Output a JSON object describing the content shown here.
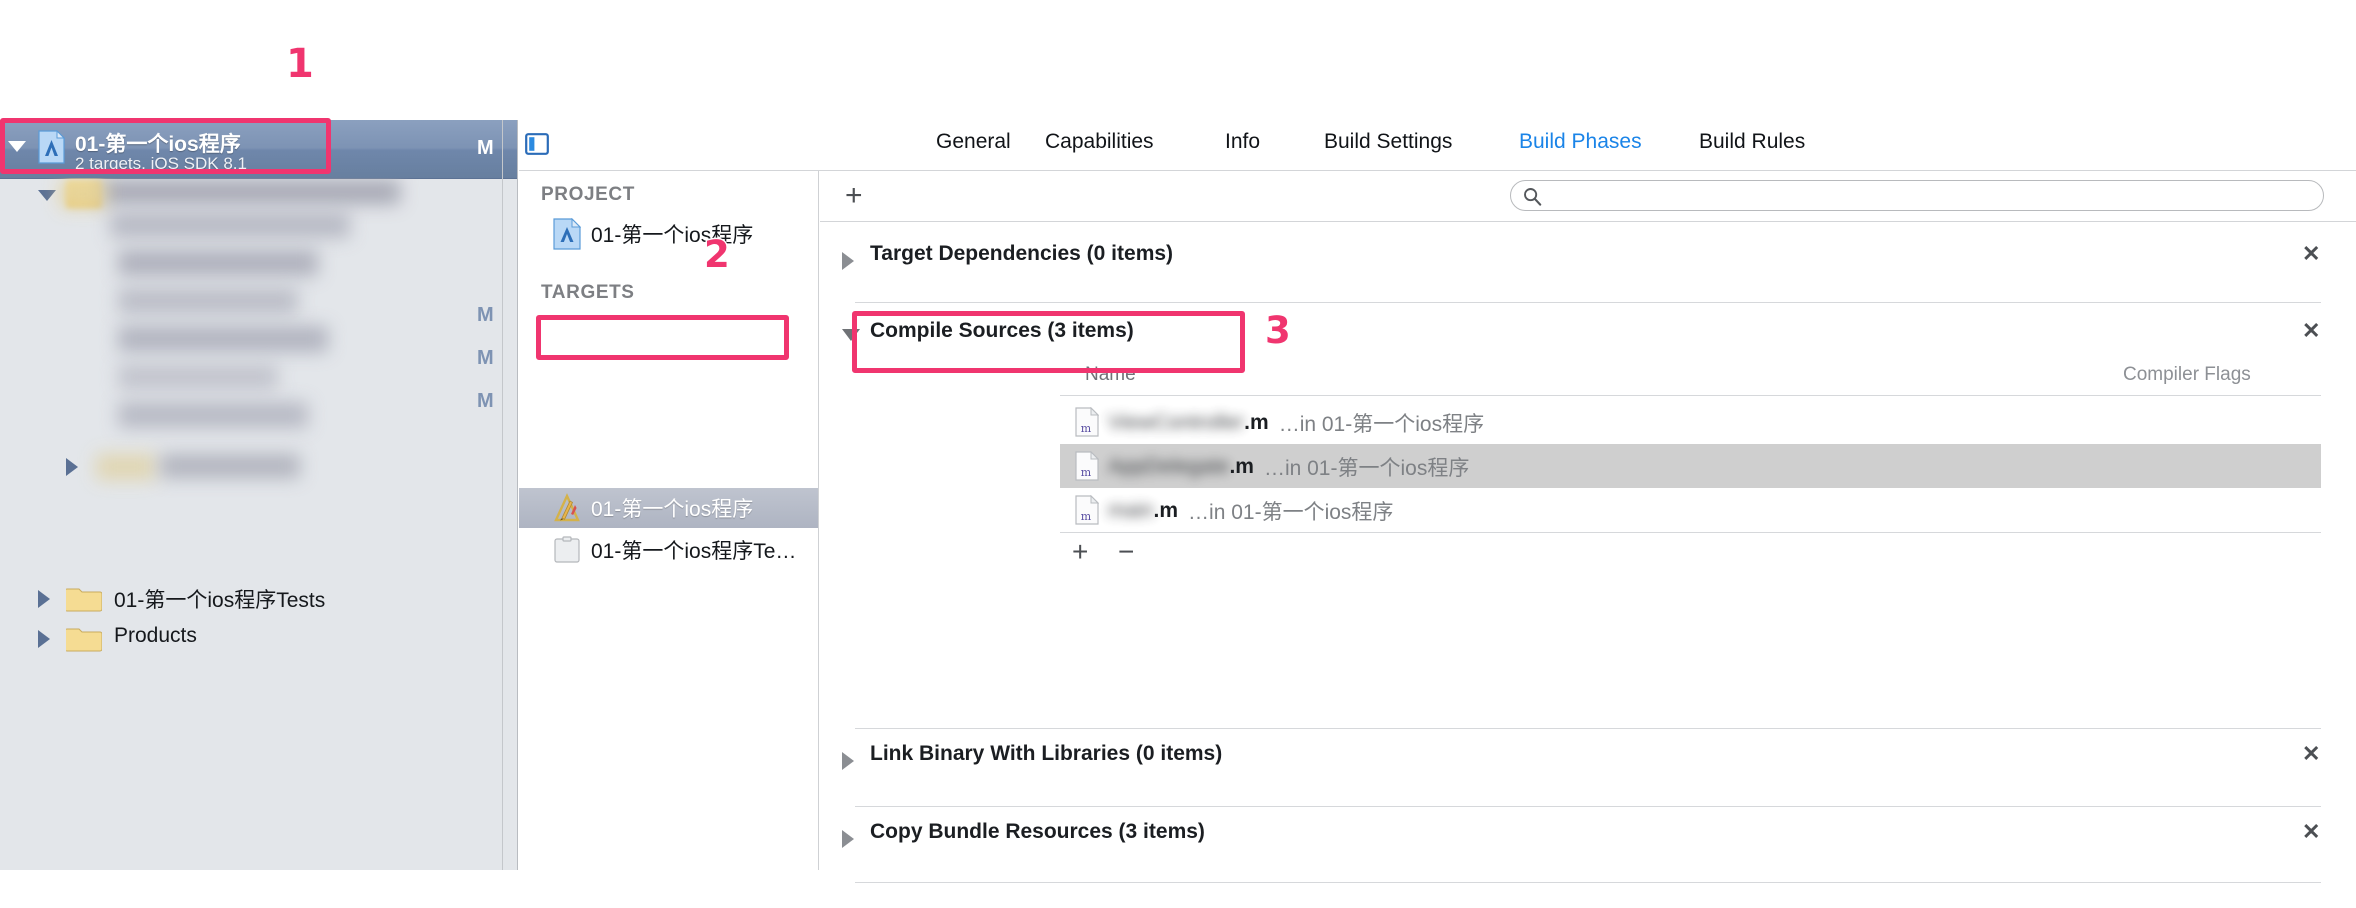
{
  "app": {
    "name": "Xcode",
    "accent_blue": "#1a84e8",
    "callout_color": "#f0356f"
  },
  "callouts": [
    {
      "id": "1",
      "label": "1",
      "target": "navigator-project-row"
    },
    {
      "id": "2",
      "label": "2",
      "target": "targets-list-app"
    },
    {
      "id": "3",
      "label": "3",
      "target": "compile-sources-header"
    }
  ],
  "navigator": {
    "project_row": {
      "title": "01-第一个ios程序",
      "subtitle": "2 targets, iOS SDK 8.1",
      "status_badge": "M",
      "icon": "xcode-project-icon",
      "disclosure": "open"
    },
    "redacted_group": {
      "note": "blurred group row",
      "disclosure": "open",
      "icon": "folder-icon"
    },
    "status_badges": [
      "M",
      "M",
      "M"
    ],
    "rows": [
      {
        "label": "01-第一个ios程序Tests",
        "icon": "folder-icon",
        "disclosure": "closed"
      },
      {
        "label": "Products",
        "icon": "folder-icon",
        "disclosure": "closed"
      }
    ]
  },
  "target_pane": {
    "project_heading": "PROJECT",
    "project_items": [
      {
        "label": "01-第一个ios程序",
        "icon": "xcode-project-icon",
        "selected": false
      }
    ],
    "targets_heading": "TARGETS",
    "target_items": [
      {
        "label": "01-第一个ios程序",
        "icon": "app-target-icon",
        "selected": true
      },
      {
        "label": "01-第一个ios程序Te…",
        "icon": "test-target-icon",
        "selected": false
      }
    ]
  },
  "editor": {
    "toggle_icon": "editor-pane-toggle-icon",
    "tabs": [
      {
        "id": "general",
        "label": "General",
        "active": false
      },
      {
        "id": "capabilities",
        "label": "Capabilities",
        "active": false
      },
      {
        "id": "info",
        "label": "Info",
        "active": false
      },
      {
        "id": "build-settings",
        "label": "Build Settings",
        "active": false
      },
      {
        "id": "build-phases",
        "label": "Build Phases",
        "active": true
      },
      {
        "id": "build-rules",
        "label": "Build Rules",
        "active": false
      }
    ],
    "toolbar": {
      "add_phase_label": "+",
      "add_phase_icon": "plus-icon",
      "search_icon": "search-icon",
      "search_value": "",
      "search_placeholder": ""
    },
    "phases": [
      {
        "id": "target-dependencies",
        "title": "Target Dependencies (0 items)",
        "expanded": false,
        "close_label": "✕"
      },
      {
        "id": "compile-sources",
        "title": "Compile Sources (3 items)",
        "expanded": true,
        "close_label": "✕",
        "table": {
          "columns": [
            "Name",
            "Compiler Flags"
          ],
          "add_label": "+",
          "remove_label": "−",
          "rows": [
            {
              "icon": "objc-m-file-icon",
              "name_redacted": "ViewController",
              "extension": ".m",
              "location": "…in 01-第一个ios程序",
              "selected": false,
              "compiler_flags": ""
            },
            {
              "icon": "objc-m-file-icon",
              "name_redacted": "AppDelegate",
              "extension": ".m",
              "location": "…in 01-第一个ios程序",
              "selected": true,
              "compiler_flags": ""
            },
            {
              "icon": "objc-m-file-icon",
              "name_redacted": "main",
              "extension": ".m",
              "location": "…in 01-第一个ios程序",
              "selected": false,
              "compiler_flags": ""
            }
          ]
        }
      },
      {
        "id": "link-binary",
        "title": "Link Binary With Libraries (0 items)",
        "expanded": false,
        "close_label": "✕"
      },
      {
        "id": "copy-bundle",
        "title": "Copy Bundle Resources (3 items)",
        "expanded": false,
        "close_label": "✕"
      }
    ]
  }
}
